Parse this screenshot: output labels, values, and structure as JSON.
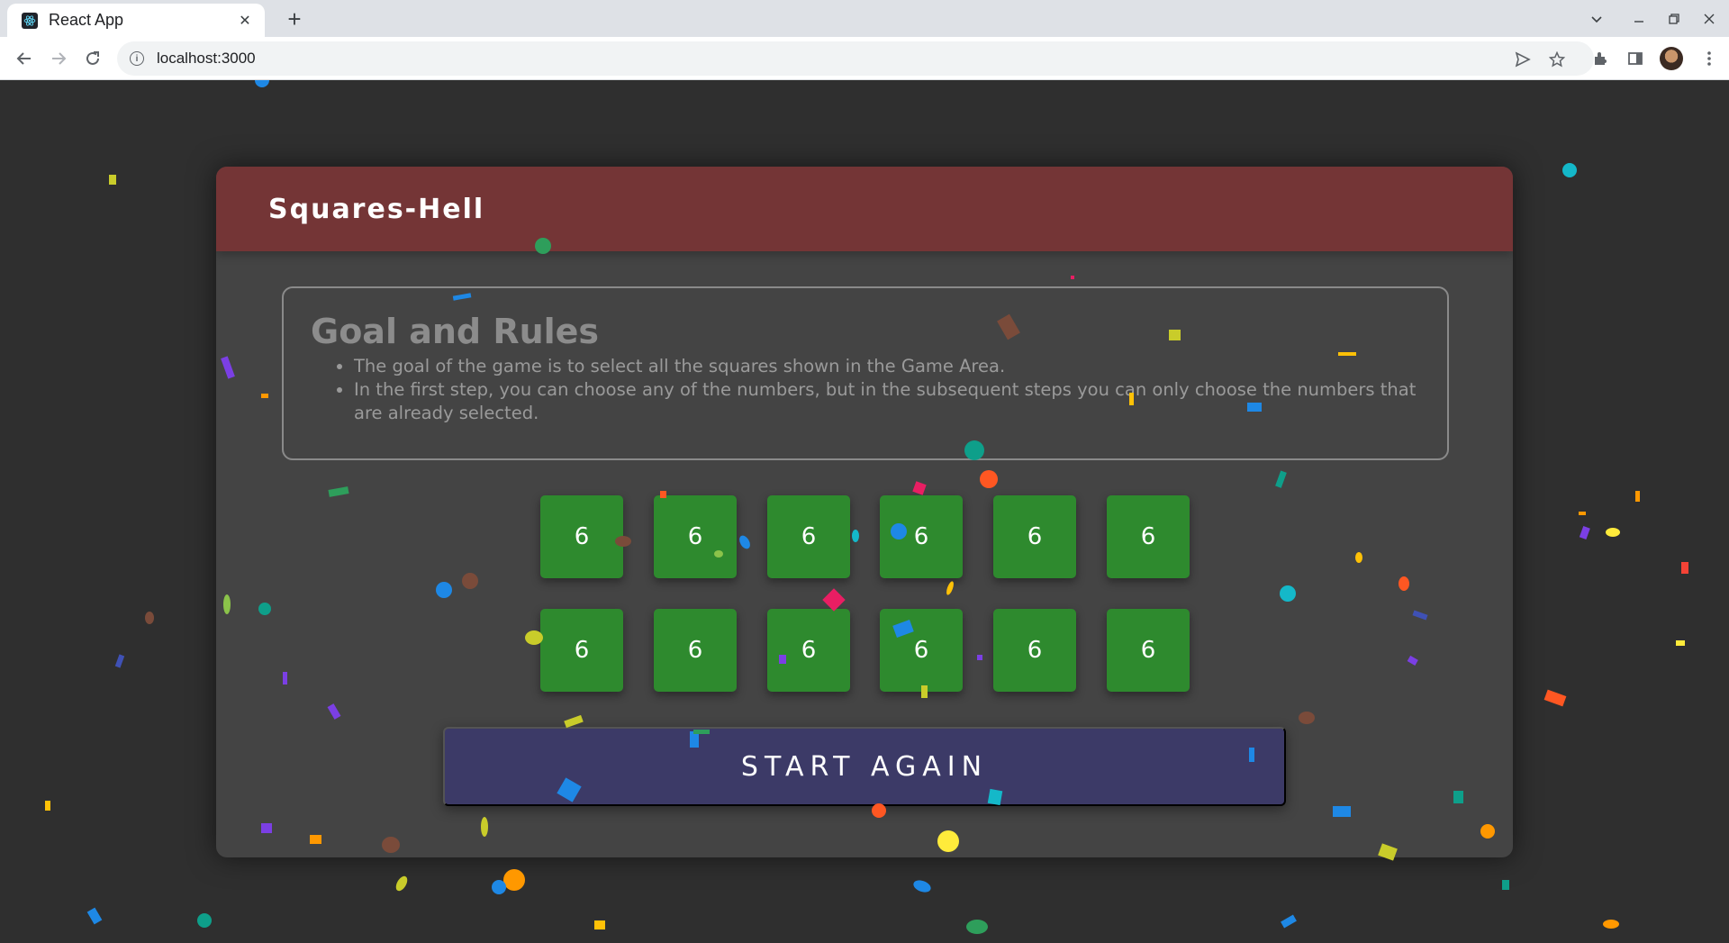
{
  "browser": {
    "tab_title": "React App",
    "tab_close": "✕",
    "new_tab": "+",
    "url": "localhost:3000"
  },
  "app": {
    "title": "Squares-Hell"
  },
  "rules": {
    "title": "Goal and Rules",
    "items": [
      "The goal of the game is to select all the squares shown in the Game Area.",
      "In the first step, you can choose any of the numbers, but in the subsequent steps you can only choose the numbers that are already selected."
    ]
  },
  "grid": {
    "rows": [
      [
        "6",
        "6",
        "6",
        "6",
        "6",
        "6"
      ],
      [
        "6",
        "6",
        "6",
        "6",
        "6",
        "6"
      ]
    ]
  },
  "start_button": {
    "label": "START AGAIN"
  },
  "colors": {
    "background": "#2f2f2f",
    "card": "#444444",
    "header": "#743536",
    "square": "#2e8a2e",
    "button": "#3c3a67"
  }
}
